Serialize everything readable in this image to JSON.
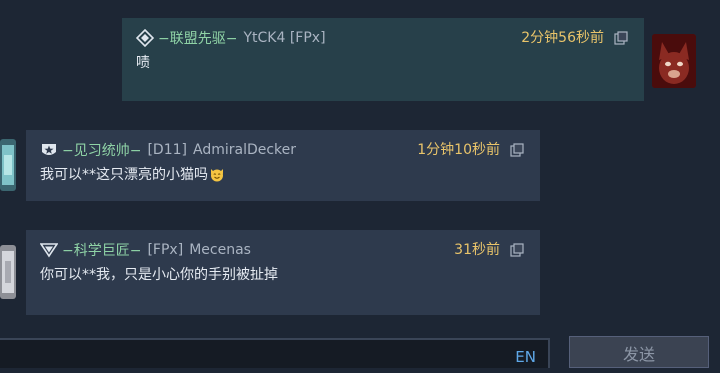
{
  "messages": [
    {
      "rank_icon": "diamond-rank-icon",
      "title": "−联盟先驱−",
      "tag": "",
      "username": "YtCK4 [FPx]",
      "time": "2分钟56秒前",
      "text": "啧",
      "from_self": true
    },
    {
      "rank_icon": "star-shield-rank-icon",
      "title": "−见习统帅−",
      "tag": "[D11]",
      "username": "AdmiralDecker",
      "time": "1分钟10秒前",
      "text": "我可以**这只漂亮的小猫吗",
      "emoji": "smiling-cat-emoji",
      "from_self": false
    },
    {
      "rank_icon": "chevron-rank-icon",
      "title": "−科学巨匠−",
      "tag": "[FPx]",
      "username": "Mecenas",
      "time": "31秒前",
      "text": "你可以**我，只是小心你的手别被扯掉",
      "from_self": false
    }
  ],
  "input": {
    "language": "EN"
  },
  "send_button": {
    "label": "发送"
  },
  "colors": {
    "background": "#1d2634",
    "self_bubble": "#27404a",
    "other_bubble": "#2e3a4d",
    "title_green": "#8fd3a6",
    "time_yellow": "#e9c46a",
    "lang_blue": "#5fa8e8"
  }
}
